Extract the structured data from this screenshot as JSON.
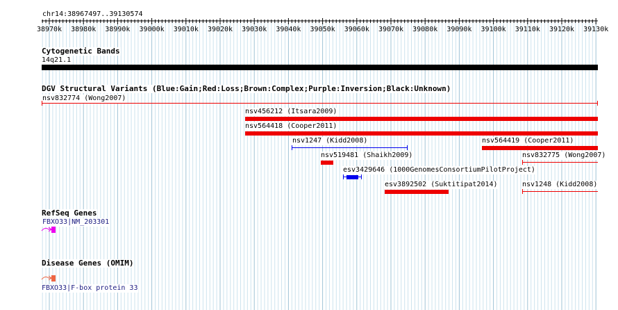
{
  "ruler": {
    "locus": "chr14:38967497..39130574",
    "ticks": [
      "38970k",
      "38980k",
      "38990k",
      "39000k",
      "39010k",
      "39020k",
      "39030k",
      "39040k",
      "39050k",
      "39060k",
      "39070k",
      "39080k",
      "39090k",
      "39100k",
      "39110k",
      "39120k",
      "39130k"
    ]
  },
  "tracks": {
    "cytoband": {
      "title": "Cytogenetic Bands",
      "band": "14q21.1"
    },
    "dgv": {
      "title": "DGV Structural Variants (Blue:Gain;Red:Loss;Brown:Complex;Purple:Inversion;Black:Unknown)",
      "variants": [
        {
          "label": "nsv832774 (Wong2007)",
          "type": "loss"
        },
        {
          "label": "nsv456212 (Itsara2009)",
          "type": "loss"
        },
        {
          "label": "nsv564418 (Cooper2011)",
          "type": "loss"
        },
        {
          "label": "nsv1247 (Kidd2008)",
          "type": "gain"
        },
        {
          "label": "nsv564419 (Cooper2011)",
          "type": "loss"
        },
        {
          "label": "nsv519481 (Shaikh2009)",
          "type": "loss"
        },
        {
          "label": "nsv832775 (Wong2007)",
          "type": "loss"
        },
        {
          "label": "esv3429646 (1000GenomesConsortiumPilotProject)",
          "type": "gain"
        },
        {
          "label": "esv3892502 (Suktitipat2014)",
          "type": "loss"
        },
        {
          "label": "nsv1248 (Kidd2008)",
          "type": "loss"
        }
      ]
    },
    "refseq": {
      "title": "RefSeq Genes",
      "gene": "FBXO33|NM_203301"
    },
    "omim": {
      "title": "Disease Genes (OMIM)",
      "gene": "FBXO33|F-box protein 33"
    }
  },
  "colors": {
    "loss": "#ee0000",
    "gain": "#0000ee",
    "refseq": "#ee00ee",
    "omim": "#ee6644",
    "grid_major": "#9fc3d6",
    "grid_minor": "#cde3ee",
    "cytoband": "#000000"
  }
}
